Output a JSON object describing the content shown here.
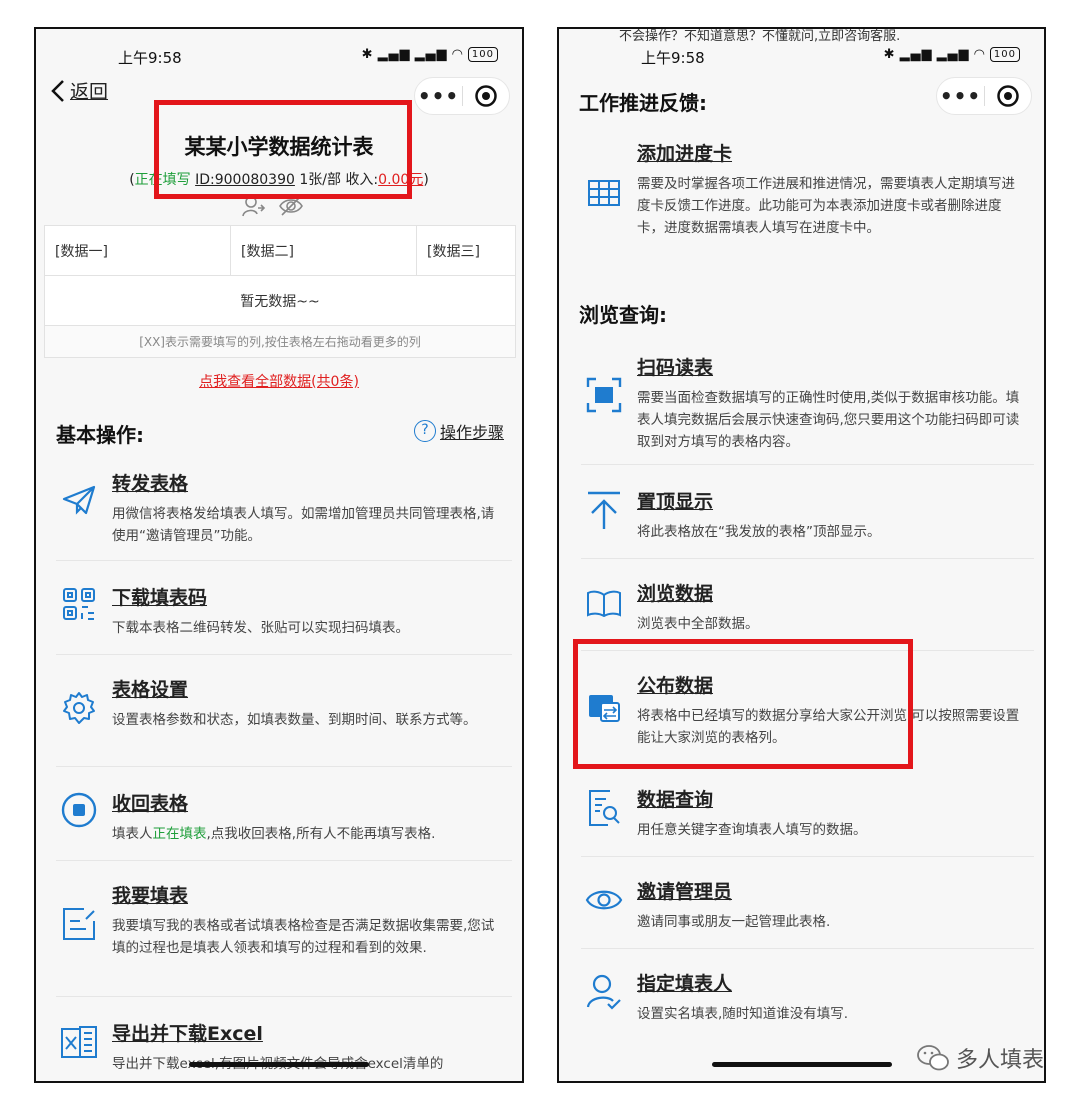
{
  "left": {
    "status": {
      "time": "上午9:58",
      "battery": "100"
    },
    "back_label": "返回",
    "title": "某某小学数据统计表",
    "status_text": "正在填写",
    "id_text": "ID:900080390",
    "limit_text": "1张/部",
    "income_label": "收入:",
    "income_value": "0.00元",
    "columns": [
      "[数据一]",
      "[数据二]",
      "[数据三]"
    ],
    "empty_text": "暂无数据~~",
    "hint_text": "[XX]表示需要填写的列,按住表格左右拖动看更多的列",
    "view_all_text": "点我查看全部数据(共0条)",
    "section_title": "基本操作:",
    "steps_label": "操作步骤",
    "items": [
      {
        "icon": "paper-plane-icon",
        "title": "转发表格",
        "desc": "用微信将表格发给填表人填写。如需增加管理员共同管理表格,请使用“邀请管理员”功能。"
      },
      {
        "icon": "qr-code-icon",
        "title": "下载填表码",
        "desc": "下载本表格二维码转发、张贴可以实现扫码填表。"
      },
      {
        "icon": "gear-icon",
        "title": "表格设置",
        "desc": "设置表格参数和状态，如填表数量、到期时间、联系方式等。"
      },
      {
        "icon": "stop-icon",
        "title": "收回表格",
        "desc_pre": "填表人",
        "desc_green": "正在填表",
        "desc_post": ",点我收回表格,所有人不能再填写表格."
      },
      {
        "icon": "edit-form-icon",
        "title": "我要填表",
        "desc": "我要填写我的表格或者试填表格检查是否满足数据收集需要,您试填的过程也是填表人领表和填写的过程和看到的效果."
      },
      {
        "icon": "excel-icon",
        "title": "导出并下载Excel",
        "desc": "导出并下载excel,有图片视频文件会导成含excel清单的"
      }
    ]
  },
  "right": {
    "status": {
      "time": "上午9:58",
      "battery": "100"
    },
    "top_cut_text": "不会操作？不知道意思？不懂就问,立即咨询客服.",
    "section1_title": "工作推进反馈:",
    "section2_title": "浏览查询:",
    "items1": [
      {
        "icon": "table-grid-icon",
        "title": "添加进度卡",
        "desc": "需要及时掌握各项工作进展和推进情况，需要填表人定期填写进度卡反馈工作进度。此功能可为本表添加进度卡或者删除进度卡，进度数据需填表人填写在进度卡中。"
      }
    ],
    "items2": [
      {
        "icon": "scan-icon",
        "title": "扫码读表",
        "desc": "需要当面检查数据填写的正确性时使用,类似于数据审核功能。填表人填完数据后会展示快速查询码,您只要用这个功能扫码即可读取到对方填写的表格内容。"
      },
      {
        "icon": "pin-top-icon",
        "title": "置顶显示",
        "desc": "将此表格放在“我发放的表格”顶部显示。"
      },
      {
        "icon": "book-icon",
        "title": "浏览数据",
        "desc": "浏览表中全部数据。"
      },
      {
        "icon": "publish-icon",
        "title": "公布数据",
        "desc": "将表格中已经填写的数据分享给大家公开浏览,可以按照需要设置能让大家浏览的表格列。"
      },
      {
        "icon": "doc-search-icon",
        "title": "数据查询",
        "desc": "用任意关键字查询填表人填写的数据。"
      },
      {
        "icon": "eye-icon",
        "title": "邀请管理员",
        "desc": "邀请同事或朋友一起管理此表格."
      },
      {
        "icon": "user-check-icon",
        "title": "指定填表人",
        "desc": "设置实名填表,随时知道谁没有填写."
      }
    ]
  },
  "watermark": "多人填表",
  "colors": {
    "accent_blue": "#1f7ccf",
    "highlight_red": "#e3161b",
    "status_green": "#1e9e3a"
  }
}
